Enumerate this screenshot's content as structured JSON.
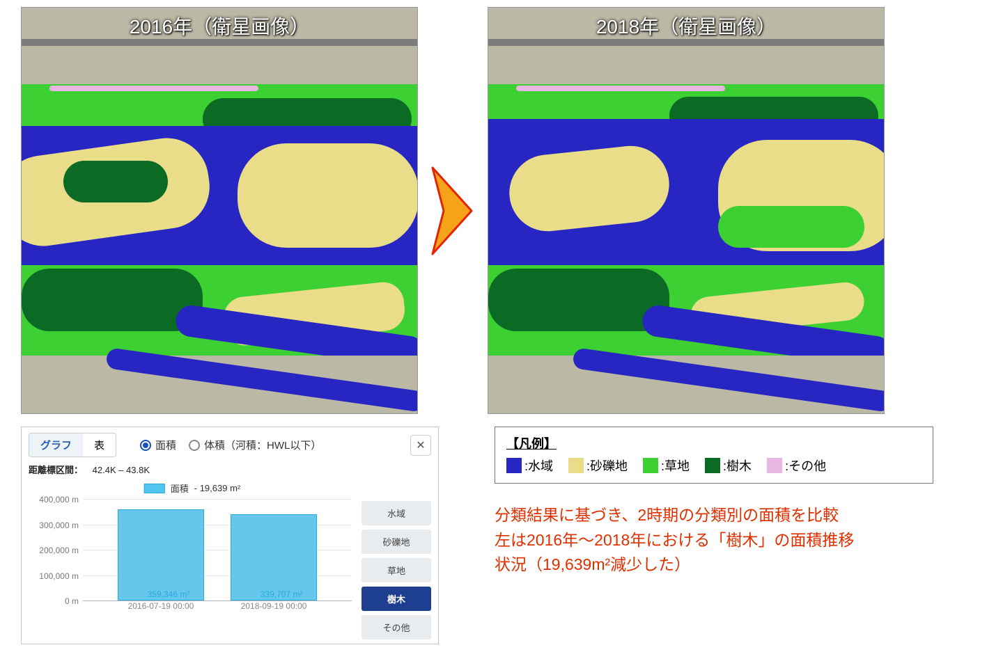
{
  "maps": {
    "left_title": "2016年（衛星画像）",
    "right_title": "2018年（衛星画像）"
  },
  "panel": {
    "tab_graph": "グラフ",
    "tab_table": "表",
    "radio_area": "面積",
    "radio_volume": "体積（河積：HWL以下）",
    "distance_label": "距離標区間：",
    "distance_value": "42.4K – 43.8K",
    "chart_legend_label": "面積",
    "chart_legend_diff": "- 19,639 m²",
    "categories": {
      "water": "水域",
      "gravel": "砂礫地",
      "grass": "草地",
      "trees": "樹木",
      "other": "その他"
    }
  },
  "legend": {
    "title": "【凡例】",
    "water": ":水域",
    "gravel": ":砂礫地",
    "grass": ":草地",
    "trees": ":樹木",
    "other": ":その他"
  },
  "caption": {
    "l1": "分類結果に基づき、2時期の分類別の面積を比較",
    "l2": "左は2016年～2018年における「樹木」の面積推移",
    "l3": "状況（19,639m²減少した）"
  },
  "colors": {
    "water": "#2726c3",
    "sand": "#e9dd8a",
    "grass": "#3cd033",
    "trees": "#0b6b24",
    "other": "#e9b6e4"
  },
  "chart_data": {
    "type": "bar",
    "title": "面積 - 19,639 m²",
    "ylabel": "m²",
    "ylim": [
      0,
      400000
    ],
    "yticks": [
      0,
      100000,
      200000,
      300000,
      400000
    ],
    "ytick_labels": [
      "0 m",
      "100,000 m",
      "200,000 m",
      "300,000 m",
      "400,000 m"
    ],
    "categories": [
      "2016-07-19 00:00",
      "2018-09-19 00:00"
    ],
    "values": [
      359346,
      339707
    ],
    "value_labels": [
      "359,346 m²",
      "339,707 m²"
    ],
    "diff": -19639,
    "selected_category": "樹木"
  }
}
